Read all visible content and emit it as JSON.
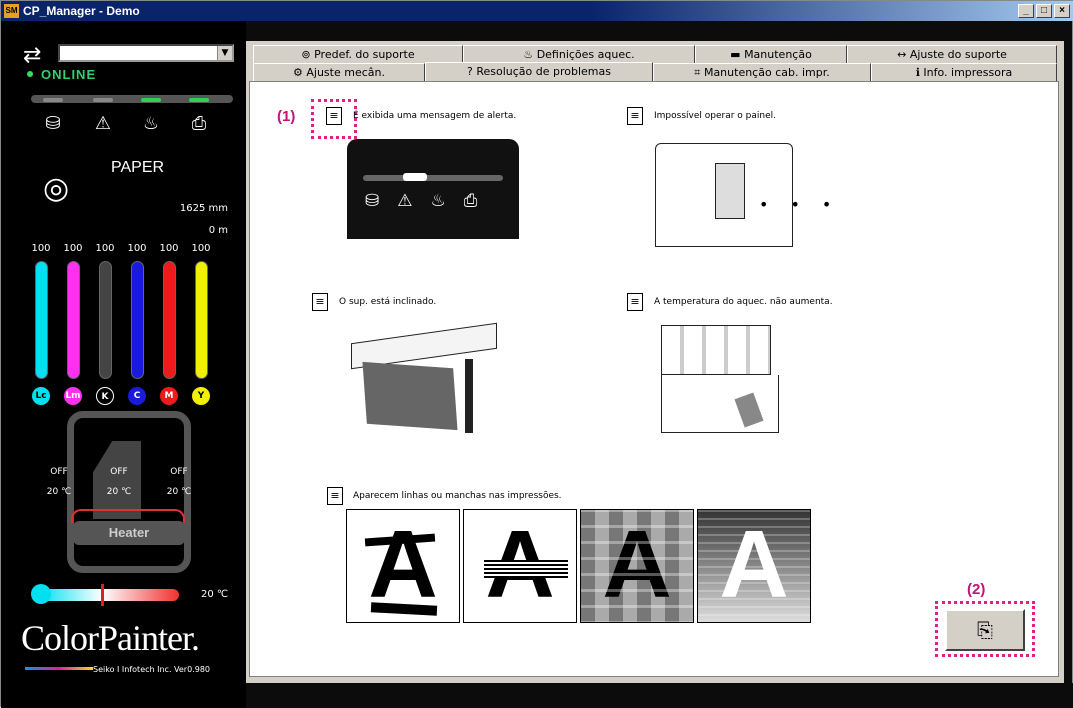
{
  "window": {
    "title": "CP_Manager - Demo",
    "app_icon": "SM",
    "buttons": [
      "_",
      "□",
      "×"
    ]
  },
  "left_panel": {
    "status": "ONLINE",
    "media_label": "PAPER",
    "width": "1625 mm",
    "length": "0 m",
    "ink": [
      {
        "name": "Lc",
        "level": "100",
        "color": "#00e0f0",
        "fill": 1.0
      },
      {
        "name": "Lm",
        "level": "100",
        "color": "#ff30f0",
        "fill": 1.0
      },
      {
        "name": "K",
        "level": "100",
        "color": "#444444",
        "fill": 1.0
      },
      {
        "name": "C",
        "level": "100",
        "color": "#1a1adf",
        "fill": 1.0
      },
      {
        "name": "M",
        "level": "100",
        "color": "#ef1a1a",
        "fill": 1.0
      },
      {
        "name": "Y",
        "level": "100",
        "color": "#f0f000",
        "fill": 1.0
      }
    ],
    "heater": {
      "label": "Heater",
      "zones": [
        {
          "state": "OFF",
          "temp": "20 ℃"
        },
        {
          "state": "OFF",
          "temp": "20 ℃"
        },
        {
          "state": "OFF",
          "temp": "20 ℃"
        }
      ],
      "slider_temp": "20 ℃"
    },
    "logo": "ColorPainter.",
    "company": "Seiko I Infotech Inc.  Ver0.980"
  },
  "tabs_row1": [
    "Predef. do suporte",
    "Definições aquec.",
    "Manutenção",
    "Ajuste do suporte"
  ],
  "tabs_row2": [
    "Ajuste mecân.",
    "Resolução de problemas",
    "Manutenção cab. impr.",
    "Info. impressora"
  ],
  "content": {
    "items": [
      "É exibida uma mensagem de alerta.",
      "Impossível operar o painel.",
      "O sup. está inclinado.",
      "A temperatura do aquec. não aumenta.",
      "Aparecem linhas ou manchas nas impressões."
    ],
    "annotation1": "(1)",
    "annotation2": "(2)",
    "sample_letter": "A"
  }
}
